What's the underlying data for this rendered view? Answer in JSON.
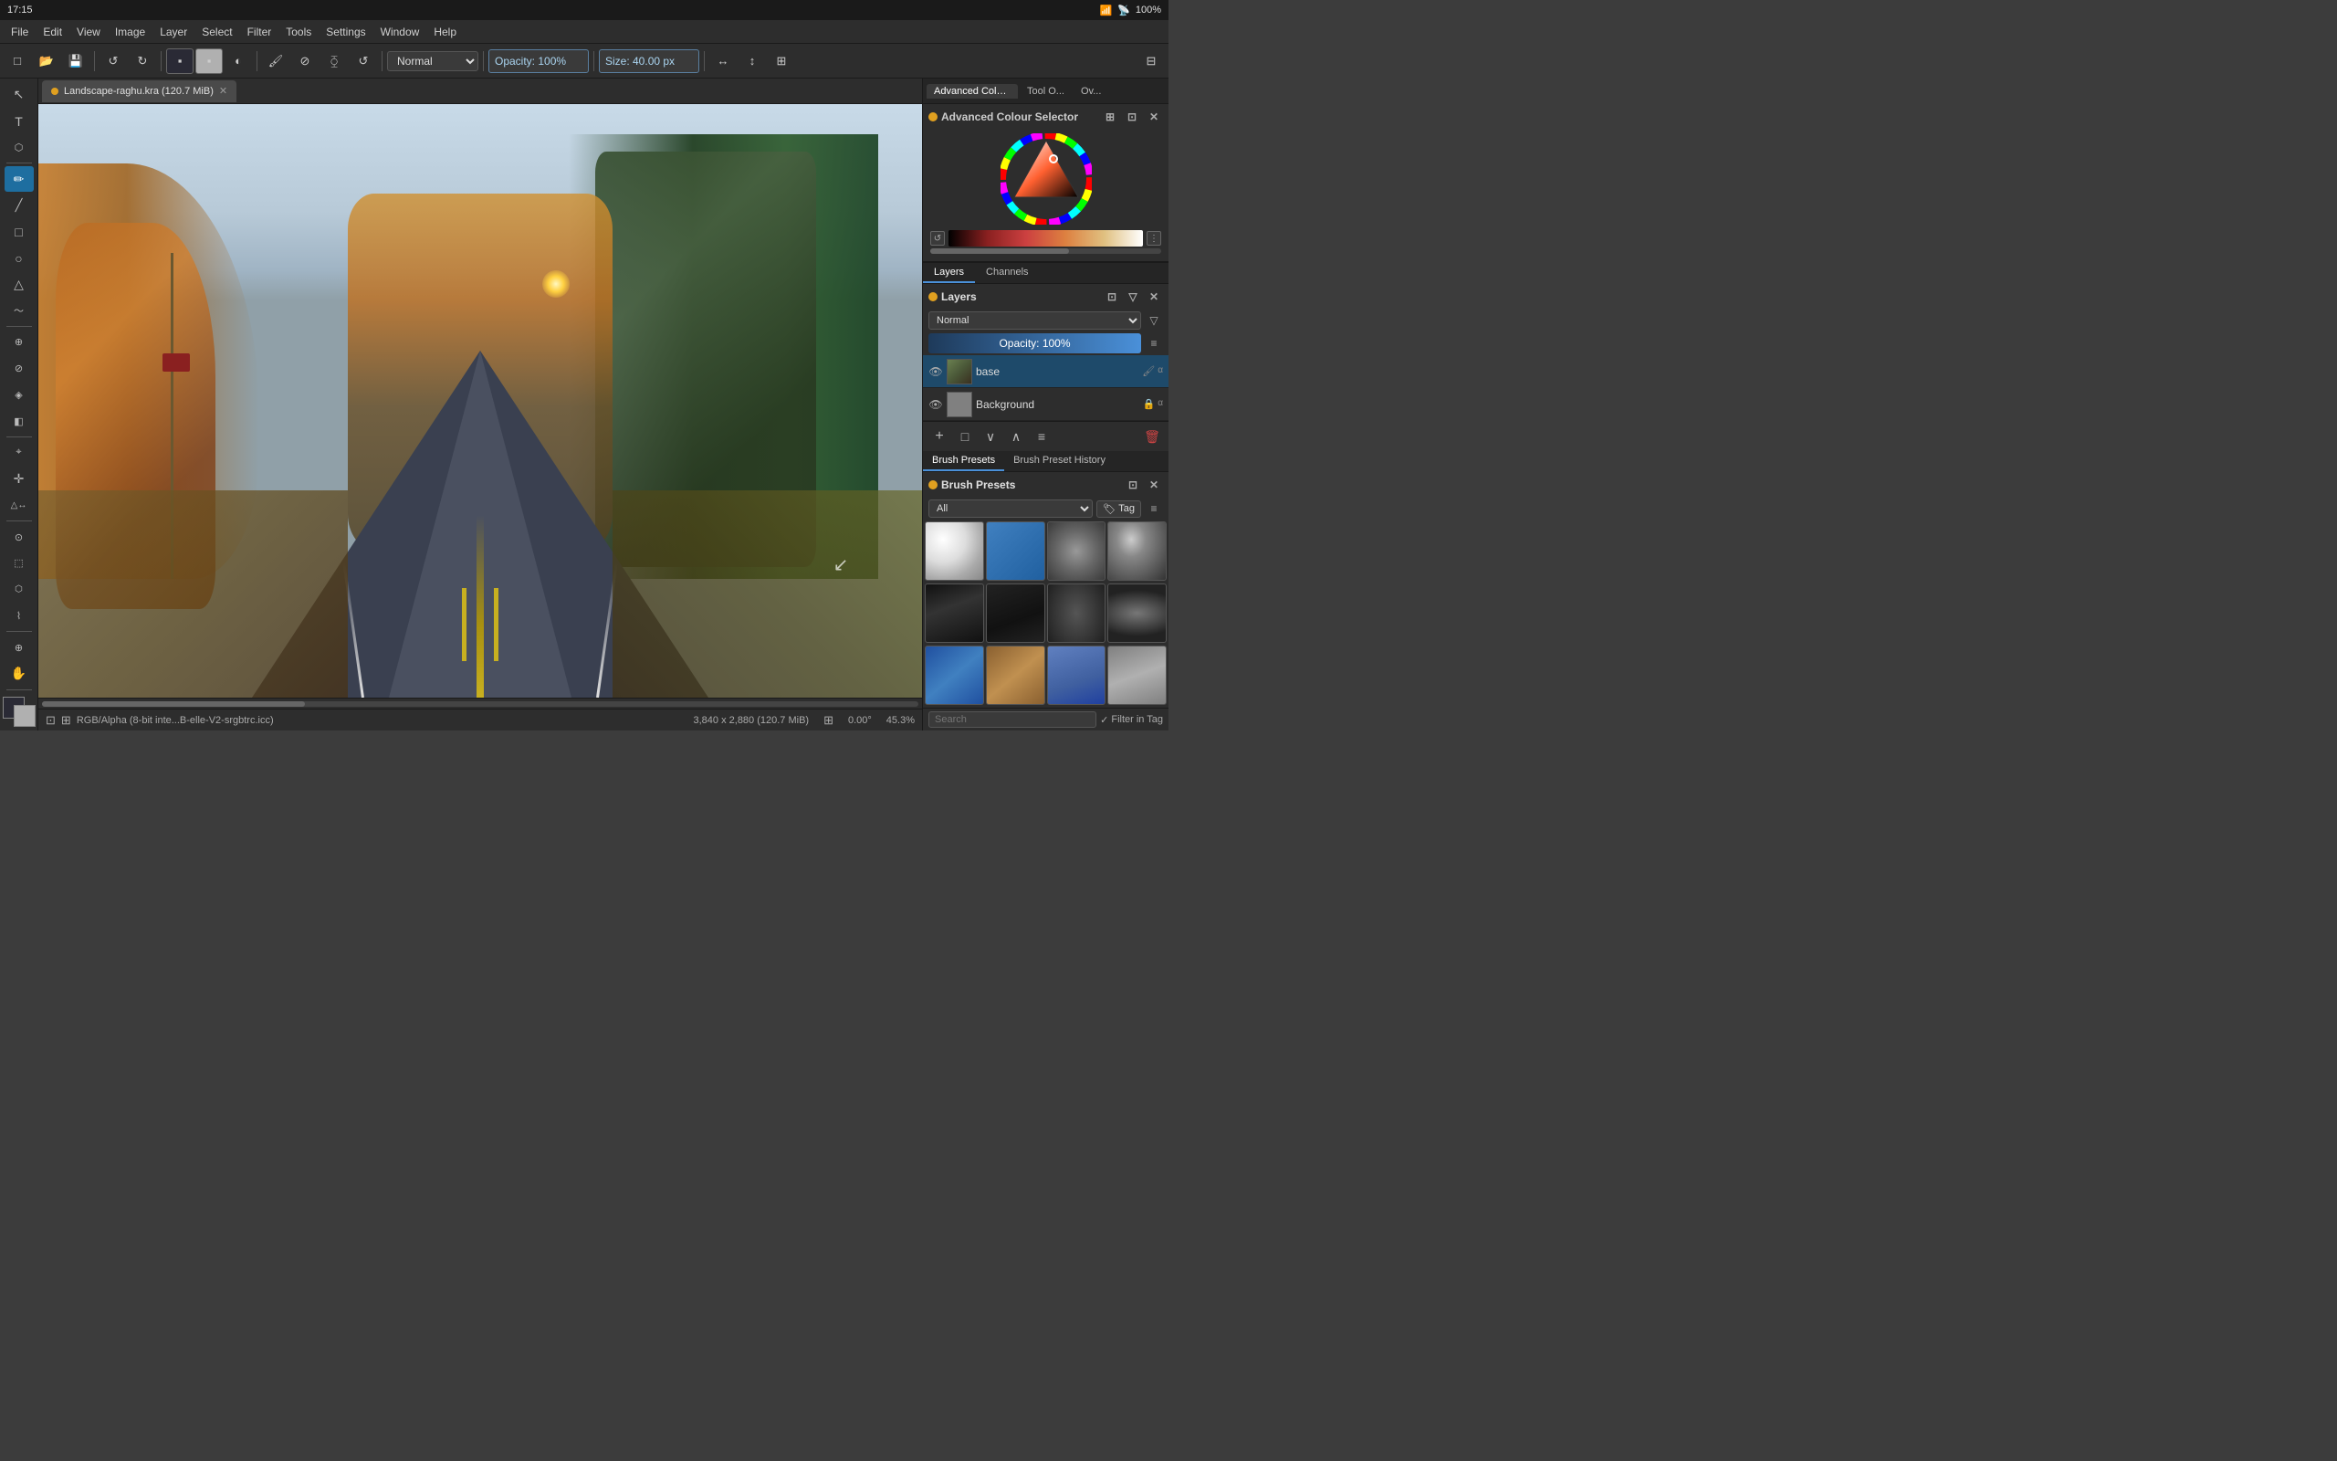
{
  "titlebar": {
    "time": "17:15",
    "battery": "100%"
  },
  "menubar": {
    "items": [
      "File",
      "Edit",
      "View",
      "Image",
      "Layer",
      "Select",
      "Filter",
      "Tools",
      "Settings",
      "Window",
      "Help"
    ]
  },
  "toolbar": {
    "blend_mode": "Normal",
    "opacity_label": "Opacity: 100%",
    "size_label": "Size: 40.00 px"
  },
  "canvas": {
    "tab_title": "Landscape-raghu.kra (120.7 MiB)"
  },
  "colour_selector": {
    "title": "Advanced Colour Selector",
    "panel_tabs": [
      "Advanced Colour Se...",
      "Tool O...",
      "Ov..."
    ]
  },
  "layers": {
    "title": "Layers",
    "tabs": [
      "Layers",
      "Channels"
    ],
    "blend_mode": "Normal",
    "opacity": "Opacity:  100%",
    "items": [
      {
        "name": "base",
        "type": "paint",
        "selected": true
      },
      {
        "name": "Background",
        "type": "background",
        "locked": true
      }
    ],
    "toolbar_buttons": [
      "+",
      "□",
      "∨",
      "∧",
      "≡",
      "🗑"
    ]
  },
  "brush_presets": {
    "title": "Brush Presets",
    "tabs": [
      "Brush Presets",
      "Brush Preset History"
    ],
    "panel_title": "Brush Presets",
    "filter_label": "All",
    "tag_label": "Tag",
    "search_placeholder": "Search",
    "filter_in_tag": "Filter in Tag",
    "brushes": [
      {
        "id": 1,
        "style": "brush-eraser"
      },
      {
        "id": 2,
        "style": "brush-pencil-blue"
      },
      {
        "id": 3,
        "style": "brush-soft"
      },
      {
        "id": 4,
        "style": "brush-hard"
      },
      {
        "id": 5,
        "style": "brush-ink1"
      },
      {
        "id": 6,
        "style": "brush-ink2"
      },
      {
        "id": 7,
        "style": "brush-ink3"
      },
      {
        "id": 8,
        "style": "brush-ink4"
      },
      {
        "id": 9,
        "style": "brush-blue2"
      },
      {
        "id": 10,
        "style": "brush-brown"
      },
      {
        "id": 11,
        "style": "brush-wr"
      },
      {
        "id": 12,
        "style": "brush-grey"
      }
    ]
  },
  "statusbar": {
    "color_mode": "RGB/Alpha (8-bit inte...B-elle-V2-srgbtrc.icc)",
    "dimensions": "3,840 x 2,880 (120.7 MiB)",
    "rotation": "0.00°",
    "zoom": "45.3%"
  },
  "tools": [
    {
      "id": "select",
      "icon": "↖",
      "tooltip": "Select"
    },
    {
      "id": "text",
      "icon": "T",
      "tooltip": "Text"
    },
    {
      "id": "transform",
      "icon": "⬡",
      "tooltip": "Transform"
    },
    {
      "id": "brush",
      "icon": "✏",
      "tooltip": "Brush",
      "active": true
    },
    {
      "id": "line",
      "icon": "╱",
      "tooltip": "Line"
    },
    {
      "id": "rect",
      "icon": "□",
      "tooltip": "Rectangle"
    },
    {
      "id": "ellipse",
      "icon": "○",
      "tooltip": "Ellipse"
    },
    {
      "id": "polygon",
      "icon": "△",
      "tooltip": "Polygon"
    },
    {
      "id": "freehand",
      "icon": "〜",
      "tooltip": "Freehand"
    },
    {
      "id": "smart-patch",
      "icon": "⊕",
      "tooltip": "Smart Patch"
    },
    {
      "id": "clone",
      "icon": "⊘",
      "tooltip": "Clone"
    },
    {
      "id": "fill",
      "icon": "◈",
      "tooltip": "Fill"
    },
    {
      "id": "gradient",
      "icon": "◧",
      "tooltip": "Gradient"
    },
    {
      "id": "crop",
      "icon": "⌖",
      "tooltip": "Crop"
    },
    {
      "id": "move",
      "icon": "✛",
      "tooltip": "Move"
    },
    {
      "id": "measure",
      "icon": "△↔",
      "tooltip": "Measure"
    },
    {
      "id": "sample",
      "icon": "⊙",
      "tooltip": "Color Sample"
    },
    {
      "id": "contiguous",
      "icon": "⬚",
      "tooltip": "Contiguous"
    },
    {
      "id": "polygon-select",
      "icon": "⬡",
      "tooltip": "Polygon Select"
    },
    {
      "id": "magnetic",
      "icon": "⌇",
      "tooltip": "Magnetic"
    },
    {
      "id": "zoom",
      "icon": "⊕",
      "tooltip": "Zoom"
    },
    {
      "id": "pan",
      "icon": "✋",
      "tooltip": "Pan"
    }
  ]
}
